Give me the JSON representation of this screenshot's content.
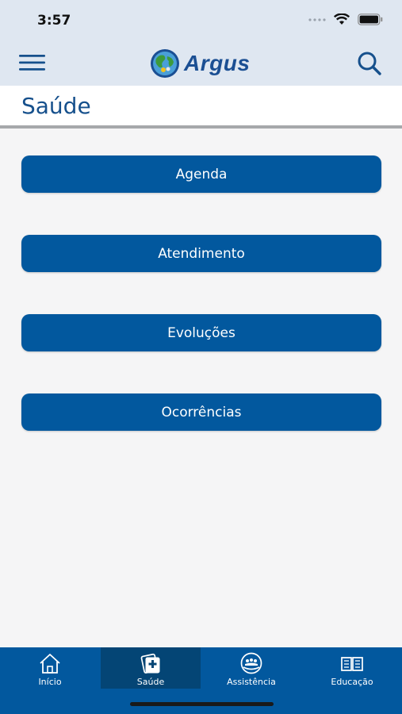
{
  "status_bar": {
    "time": "3:57"
  },
  "header": {
    "logo_text": "Argus"
  },
  "page": {
    "title": "Saúde"
  },
  "buttons": [
    {
      "label": "Agenda"
    },
    {
      "label": "Atendimento"
    },
    {
      "label": "Evoluções"
    },
    {
      "label": "Ocorrências"
    }
  ],
  "tabs": [
    {
      "label": "Início",
      "icon": "home-icon",
      "active": false
    },
    {
      "label": "Saúde",
      "icon": "medical-clipboard-icon",
      "active": true
    },
    {
      "label": "Assistência",
      "icon": "assistance-icon",
      "active": false
    },
    {
      "label": "Educação",
      "icon": "book-icon",
      "active": false
    }
  ],
  "colors": {
    "primary": "#02589e",
    "header_bg": "#dfe7f1",
    "title_text": "#16508c",
    "active_tab": "#044575"
  }
}
